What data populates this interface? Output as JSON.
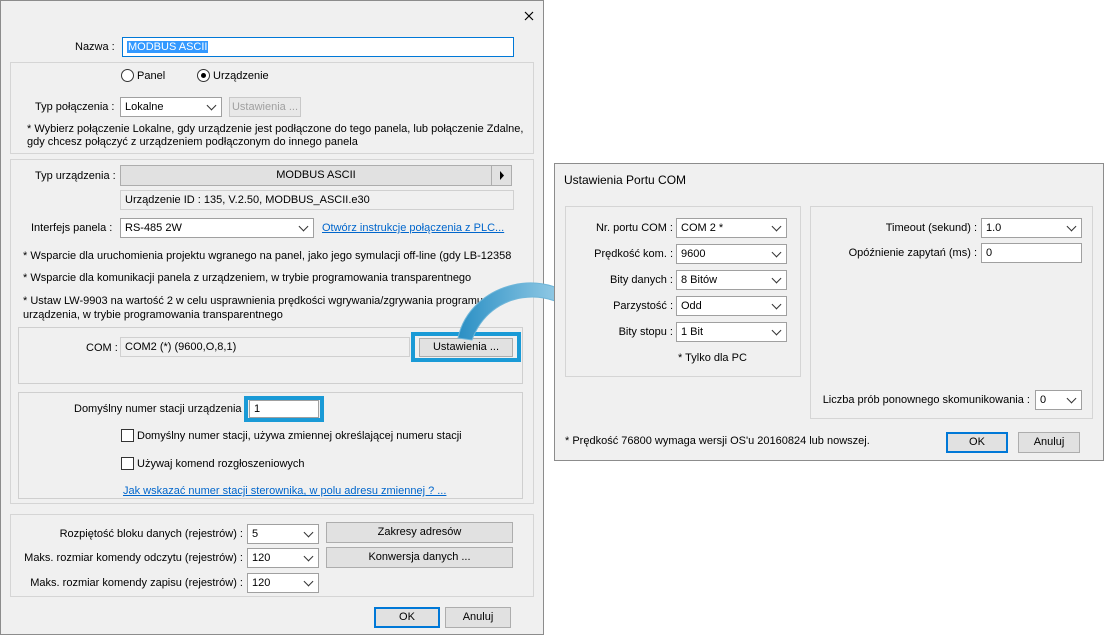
{
  "main_dialog": {
    "nazwa_label": "Nazwa :",
    "nazwa_value": "MODBUS ASCII",
    "radio_panel": "Panel",
    "radio_urzadzenie": "Urządzenie",
    "typ_polaczenia_label": "Typ połączenia :",
    "typ_polaczenia_value": "Lokalne",
    "ustawienia_disabled": "Ustawienia ...",
    "note_connection": "* Wybierz połączenie Lokalne, gdy urządzenie jest podłączone do tego panela, lub połączenie Zdalne, gdy chcesz połączyć z urządzeniem podłączonym do innego panela",
    "typ_urzadzenia_label": "Typ urządzenia :",
    "typ_urzadzenia_value": "MODBUS ASCII",
    "device_id": "Urządzenie ID : 135, V.2.50, MODBUS_ASCII.e30",
    "interfejs_label": "Interfejs panela :",
    "interfejs_value": "RS-485 2W",
    "instrukcje_link": "Otwórz instrukcje połączenia z PLC...",
    "note1": "* Wsparcie dla uruchomienia projektu wgranego na panel, jako jego symulacji off-line (gdy LB-12358",
    "note2": "* Wsparcie dla komunikacji panela z urządzeniem, w trybie programowania transparentnego",
    "note3_line1": "* Ustaw LW-9903 na wartość 2 w celu usprawnienia prędkości wgrywania/zgrywania programu",
    "note3_line2": "urządzenia, w trybie programowania transparentnego",
    "com_label": "COM :",
    "com_value": "COM2 (*) (9600,O,8,1)",
    "ustawienia_button": "Ustawienia ...",
    "station_label": "Domyślny numer stacji urządzenia :",
    "station_value": "1",
    "checkbox1": "Domyślny numer stacji, używa zmiennej określającej numeru stacji",
    "checkbox2": "Używaj komend rozgłoszeniowych",
    "station_link": "Jak wskazać numer stacji sterownika, w polu adresu zmiennej ? ...",
    "block_label": "Rozpiętość bloku danych (rejestrów) :",
    "block_value": "5",
    "read_label": "Maks. rozmiar komendy odczytu (rejestrów) :",
    "read_value": "120",
    "write_label": "Maks. rozmiar komendy zapisu (rejestrów) :",
    "write_value": "120",
    "zakresy_button": "Zakresy adresów",
    "konwersja_button": "Konwersja danych ...",
    "ok": "OK",
    "anuluj": "Anuluj"
  },
  "com_dialog": {
    "title": "Ustawienia Portu COM",
    "port_label": "Nr. portu COM :",
    "port_value": "COM 2 *",
    "baud_label": "Prędkość kom. :",
    "baud_value": "9600",
    "databits_label": "Bity danych :",
    "databits_value": "8 Bitów",
    "parity_label": "Parzystość :",
    "parity_value": "Odd",
    "stopbits_label": "Bity stopu :",
    "stopbits_value": "1 Bit",
    "pc_only": "* Tylko dla PC",
    "timeout_label": "Timeout (sekund) :",
    "timeout_value": "1.0",
    "delay_label": "Opóźnienie zapytań (ms) :",
    "delay_value": "0",
    "retry_label": "Liczba prób ponownego skomunikowania :",
    "retry_value": "0",
    "note": "* Prędkość 76800 wymaga wersji OS'u 20160824 lub nowszej.",
    "ok": "OK",
    "anuluj": "Anuluj"
  }
}
